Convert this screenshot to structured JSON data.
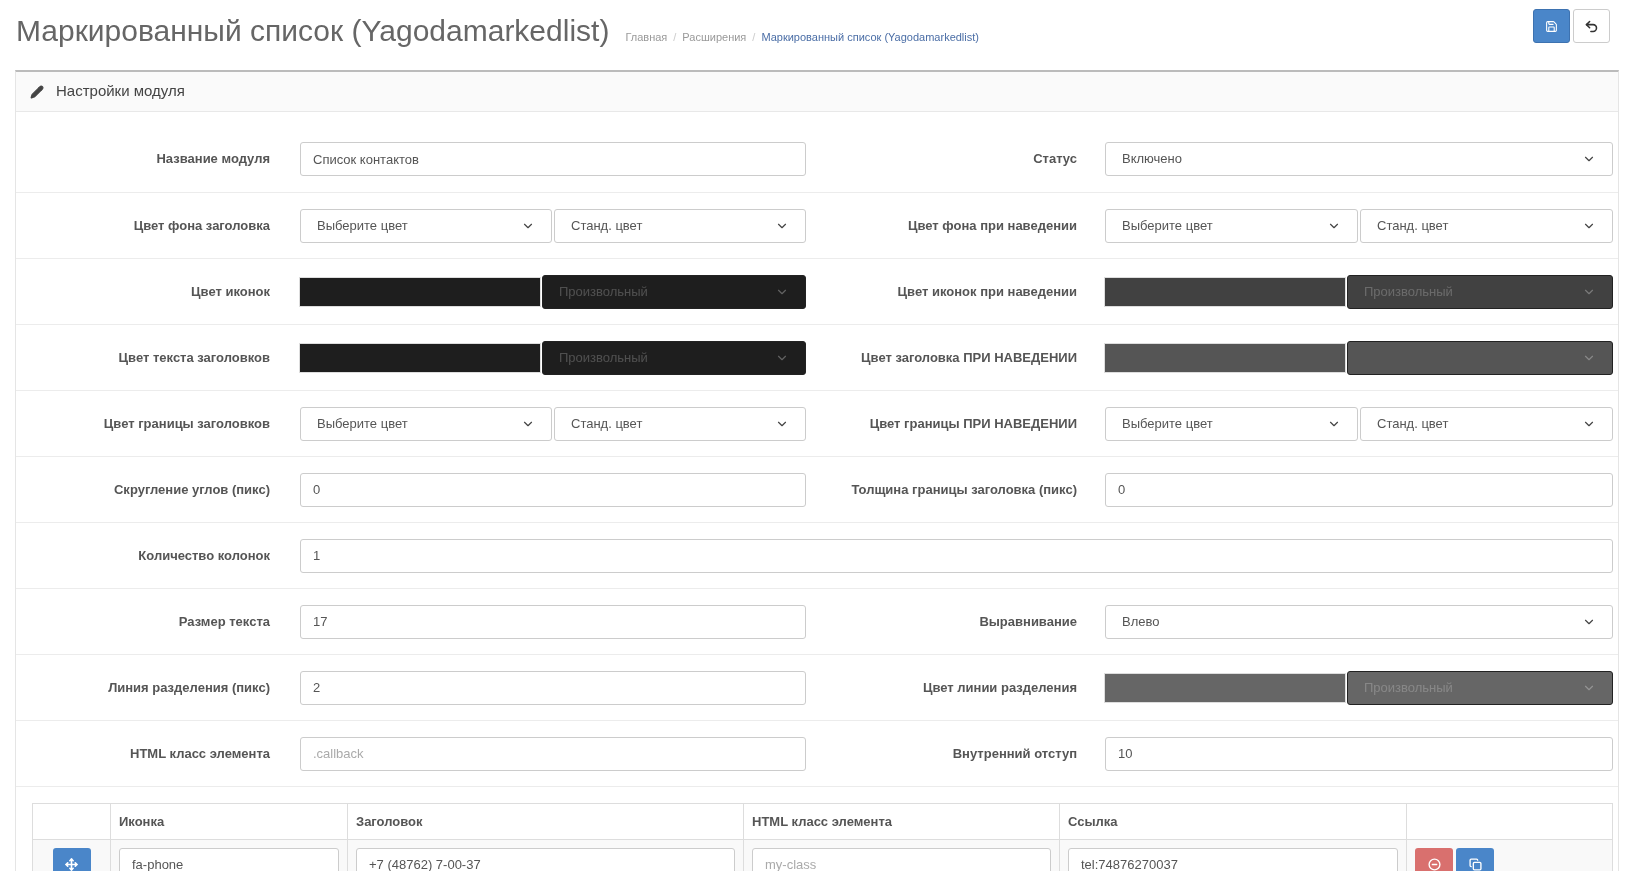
{
  "page": {
    "title": "Маркированный список (Yagodamarkedlist)",
    "breadcrumb_separator": "/",
    "breadcrumb": [
      {
        "label": "Главная",
        "current": false
      },
      {
        "label": "Расширения",
        "current": false
      },
      {
        "label": "Маркированный список (Yagodamarkedlist)",
        "current": true
      }
    ]
  },
  "panel": {
    "title": "Настройки модуля"
  },
  "rows": [
    {
      "fields": [
        {
          "label": "Название модуля",
          "kind": "input",
          "value": "Список контактов"
        },
        {
          "label": "Статус",
          "kind": "select",
          "value": "Включено"
        }
      ]
    },
    {
      "fields": [
        {
          "label": "Цвет фона заголовка",
          "kind": "select_pair",
          "values": [
            "Выберите цвет",
            "Станд. цвет"
          ]
        },
        {
          "label": "Цвет фона при наведении",
          "kind": "select_pair",
          "values": [
            "Выберите цвет",
            "Станд. цвет"
          ]
        }
      ]
    },
    {
      "fields": [
        {
          "label": "Цвет иконок",
          "kind": "color",
          "color": "#1e1e1e",
          "value": "Произвольный"
        },
        {
          "label": "Цвет иконок при наведении",
          "kind": "color",
          "color": "#414141",
          "value": "Произвольный"
        }
      ]
    },
    {
      "fields": [
        {
          "label": "Цвет текста заголовков",
          "kind": "color",
          "color": "#1e1e1e",
          "value": "Произвольный"
        },
        {
          "label": "Цвет заголовка ПРИ НАВЕДЕНИИ",
          "kind": "color",
          "color": "#555555"
        }
      ]
    },
    {
      "fields": [
        {
          "label": "Цвет границы заголовков",
          "kind": "select_pair",
          "values": [
            "Выберите цвет",
            "Станд. цвет"
          ]
        },
        {
          "label": "Цвет границы ПРИ НАВЕДЕНИИ",
          "kind": "select_pair",
          "values": [
            "Выберите цвет",
            "Станд. цвет"
          ]
        }
      ]
    },
    {
      "fields": [
        {
          "label": "Скругление углов (пикс)",
          "kind": "input",
          "value": "0"
        },
        {
          "label": "Толщина границы заголовка (пикс)",
          "kind": "input",
          "value": "0"
        }
      ]
    },
    {
      "fields": [
        {
          "label": "Количество колонок",
          "kind": "input",
          "value": "1"
        }
      ]
    },
    {
      "fields": [
        {
          "label": "Размер текста",
          "kind": "input",
          "value": "17"
        },
        {
          "label": "Выравнивание",
          "kind": "select",
          "value": "Влево"
        }
      ]
    },
    {
      "fields": [
        {
          "label": "Линия разделения (пикс)",
          "kind": "input",
          "value": "2"
        },
        {
          "label": "Цвет линии разделения",
          "kind": "color",
          "color": "#666666",
          "value": "Произвольный"
        }
      ]
    },
    {
      "fields": [
        {
          "label": "HTML класс элемента",
          "kind": "input",
          "placeholder": ".callback"
        },
        {
          "label": "Внутренний отступ",
          "kind": "input",
          "value": "10"
        }
      ]
    }
  ],
  "table": {
    "columns": [
      "Иконка",
      "Заголовок",
      "HTML класс элемента",
      "Ссылка"
    ],
    "rows": [
      {
        "icon": "fa-phone",
        "title": "+7 (48762) 7-00-37",
        "css_class": {
          "placeholder": "my-class"
        },
        "link": "tel:74876270037"
      }
    ]
  }
}
